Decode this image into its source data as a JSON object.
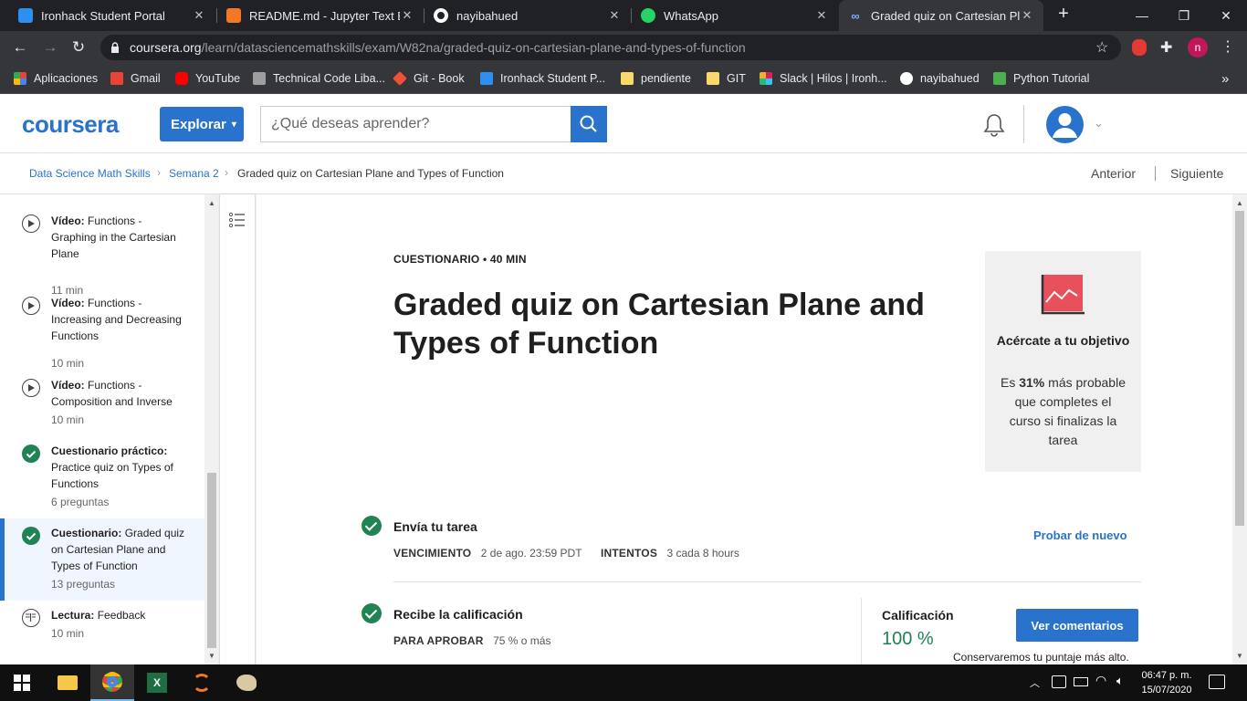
{
  "browser": {
    "tabs": [
      {
        "title": "Ironhack Student Portal",
        "icon": "ironhack-icon"
      },
      {
        "title": "README.md - Jupyter Text Edit",
        "icon": "jupyter-icon"
      },
      {
        "title": "nayibahued",
        "icon": "github-icon"
      },
      {
        "title": "WhatsApp",
        "icon": "whatsapp-icon"
      },
      {
        "title": "Graded quiz on Cartesian Plane",
        "icon": "coursera-icon",
        "active": true
      }
    ],
    "url_host": "coursera.org",
    "url_path": "/learn/datasciencemathskills/exam/W82na/graded-quiz-on-cartesian-plane-and-types-of-function",
    "profile_initial": "n",
    "bookmarks": [
      "Aplicaciones",
      "Gmail",
      "YouTube",
      "Technical Code Liba...",
      "Git - Book",
      "Ironhack Student P...",
      "pendiente",
      "GIT",
      "Slack | Hilos | Ironh...",
      "nayibahued",
      "Python Tutorial"
    ],
    "more_bookmarks": "»"
  },
  "header": {
    "logo": "coursera",
    "explore_label": "Explorar",
    "search_placeholder": "¿Qué deseas aprender?"
  },
  "breadcrumb": {
    "items": [
      "Data Science Math Skills",
      "Semana 2",
      "Graded quiz on Cartesian Plane and Types of Function"
    ],
    "prev_label": "Anterior",
    "next_label": "Siguiente"
  },
  "sidebar": {
    "items": [
      {
        "type": "Vídeo:",
        "title": "Functions - Graphing in the Cartesian Plane",
        "meta": "11 min",
        "status": "play"
      },
      {
        "type": "Vídeo:",
        "title": "Functions - Increasing and Decreasing Functions",
        "meta": "10 min",
        "status": "play"
      },
      {
        "type": "Vídeo:",
        "title": "Functions - Composition and Inverse",
        "meta": "10 min",
        "status": "play"
      },
      {
        "type": "Cuestionario práctico:",
        "title": "Practice quiz on Types of Functions",
        "meta": "6 preguntas",
        "status": "done"
      },
      {
        "type": "Cuestionario:",
        "title": "Graded quiz on Cartesian Plane and Types of Function",
        "meta": "13 preguntas",
        "status": "done",
        "selected": true
      },
      {
        "type": "Lectura:",
        "title": "Feedback",
        "meta": "10 min",
        "status": "reading"
      }
    ]
  },
  "main": {
    "kicker": "CUESTIONARIO • 40 MIN",
    "title": "Graded quiz on Cartesian Plane and Types of Function",
    "goal_card": {
      "title": "Acércate a tu objetivo",
      "body_prefix": "Es ",
      "percent": "31%",
      "body_suffix": " más probable que completes el curso si finalizas la tarea"
    },
    "submit": {
      "title": "Envía tu tarea",
      "due_label": "VENCIMIENTO",
      "due_value": "2 de ago. 23:59 PDT",
      "attempts_label": "INTENTOS",
      "attempts_value": "3 cada 8 hours",
      "retry_label": "Probar de nuevo"
    },
    "grade": {
      "title": "Recibe la calificación",
      "pass_label": "PARA APROBAR",
      "pass_value": "75 % o más",
      "grade_label": "Calificación",
      "grade_value": "100 %",
      "button_label": "Ver comentarios",
      "keep_note": "Conservaremos tu puntaje más alto."
    }
  },
  "taskbar": {
    "time": "06:47 p. m.",
    "date": "15/07/2020"
  },
  "colors": {
    "brand": "#2a73cc",
    "success": "#1f8354",
    "chrome_dark": "#202124",
    "chrome_toolbar": "#35363a"
  }
}
